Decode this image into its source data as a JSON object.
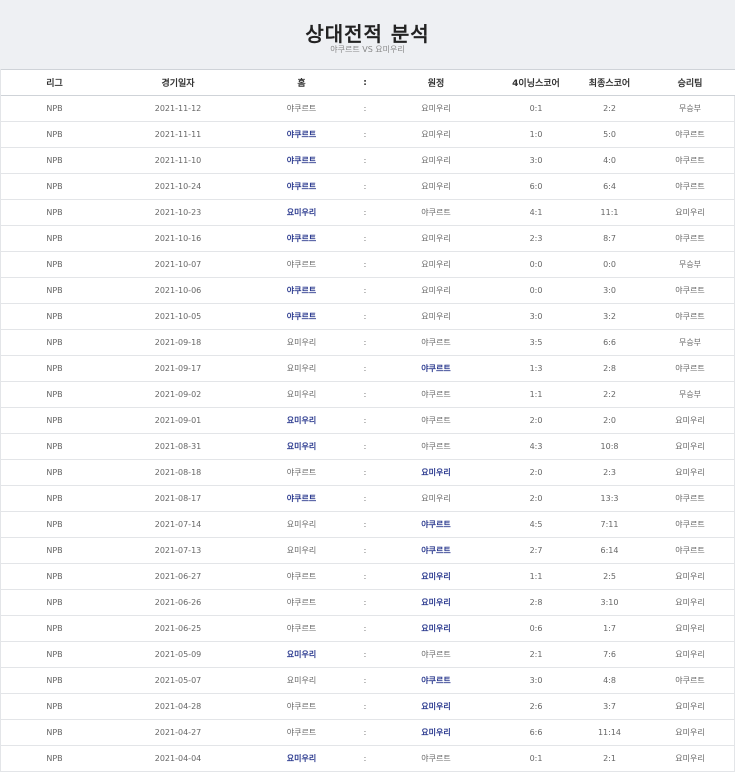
{
  "title": "상대전적 분석",
  "subtitle": "야쿠르트 VS 요미우리",
  "columns": [
    "리그",
    "경기일자",
    "홈",
    ":",
    "원정",
    "4이닝스코어",
    "최종스코어",
    "승리팀"
  ],
  "rows": [
    {
      "league": "NPB",
      "date": "2021-11-12",
      "home": "야쿠르트",
      "sep": ":",
      "away": "요미우리",
      "inning4": "0:1",
      "final": "2:2",
      "winner": "무승부",
      "win_side": "none"
    },
    {
      "league": "NPB",
      "date": "2021-11-11",
      "home": "야쿠르트",
      "sep": ":",
      "away": "요미우리",
      "inning4": "1:0",
      "final": "5:0",
      "winner": "야쿠르트",
      "win_side": "home"
    },
    {
      "league": "NPB",
      "date": "2021-11-10",
      "home": "야쿠르트",
      "sep": ":",
      "away": "요미우리",
      "inning4": "3:0",
      "final": "4:0",
      "winner": "야쿠르트",
      "win_side": "home"
    },
    {
      "league": "NPB",
      "date": "2021-10-24",
      "home": "야쿠르트",
      "sep": ":",
      "away": "요미우리",
      "inning4": "6:0",
      "final": "6:4",
      "winner": "야쿠르트",
      "win_side": "home"
    },
    {
      "league": "NPB",
      "date": "2021-10-23",
      "home": "요미우리",
      "sep": ":",
      "away": "야쿠르트",
      "inning4": "4:1",
      "final": "11:1",
      "winner": "요미우리",
      "win_side": "home"
    },
    {
      "league": "NPB",
      "date": "2021-10-16",
      "home": "야쿠르트",
      "sep": ":",
      "away": "요미우리",
      "inning4": "2:3",
      "final": "8:7",
      "winner": "야쿠르트",
      "win_side": "home"
    },
    {
      "league": "NPB",
      "date": "2021-10-07",
      "home": "야쿠르트",
      "sep": ":",
      "away": "요미우리",
      "inning4": "0:0",
      "final": "0:0",
      "winner": "무승부",
      "win_side": "none"
    },
    {
      "league": "NPB",
      "date": "2021-10-06",
      "home": "야쿠르트",
      "sep": ":",
      "away": "요미우리",
      "inning4": "0:0",
      "final": "3:0",
      "winner": "야쿠르트",
      "win_side": "home"
    },
    {
      "league": "NPB",
      "date": "2021-10-05",
      "home": "야쿠르트",
      "sep": ":",
      "away": "요미우리",
      "inning4": "3:0",
      "final": "3:2",
      "winner": "야쿠르트",
      "win_side": "home"
    },
    {
      "league": "NPB",
      "date": "2021-09-18",
      "home": "요미우리",
      "sep": ":",
      "away": "야쿠르트",
      "inning4": "3:5",
      "final": "6:6",
      "winner": "무승부",
      "win_side": "none"
    },
    {
      "league": "NPB",
      "date": "2021-09-17",
      "home": "요미우리",
      "sep": ":",
      "away": "야쿠르트",
      "inning4": "1:3",
      "final": "2:8",
      "winner": "야쿠르트",
      "win_side": "away"
    },
    {
      "league": "NPB",
      "date": "2021-09-02",
      "home": "요미우리",
      "sep": ":",
      "away": "야쿠르트",
      "inning4": "1:1",
      "final": "2:2",
      "winner": "무승부",
      "win_side": "none"
    },
    {
      "league": "NPB",
      "date": "2021-09-01",
      "home": "요미우리",
      "sep": ":",
      "away": "야쿠르트",
      "inning4": "2:0",
      "final": "2:0",
      "winner": "요미우리",
      "win_side": "home"
    },
    {
      "league": "NPB",
      "date": "2021-08-31",
      "home": "요미우리",
      "sep": ":",
      "away": "야쿠르트",
      "inning4": "4:3",
      "final": "10:8",
      "winner": "요미우리",
      "win_side": "home"
    },
    {
      "league": "NPB",
      "date": "2021-08-18",
      "home": "야쿠르트",
      "sep": ":",
      "away": "요미우리",
      "inning4": "2:0",
      "final": "2:3",
      "winner": "요미우리",
      "win_side": "away"
    },
    {
      "league": "NPB",
      "date": "2021-08-17",
      "home": "야쿠르트",
      "sep": ":",
      "away": "요미우리",
      "inning4": "2:0",
      "final": "13:3",
      "winner": "야쿠르트",
      "win_side": "home"
    },
    {
      "league": "NPB",
      "date": "2021-07-14",
      "home": "요미우리",
      "sep": ":",
      "away": "야쿠르트",
      "inning4": "4:5",
      "final": "7:11",
      "winner": "야쿠르트",
      "win_side": "away"
    },
    {
      "league": "NPB",
      "date": "2021-07-13",
      "home": "요미우리",
      "sep": ":",
      "away": "야쿠르트",
      "inning4": "2:7",
      "final": "6:14",
      "winner": "야쿠르트",
      "win_side": "away"
    },
    {
      "league": "NPB",
      "date": "2021-06-27",
      "home": "야쿠르트",
      "sep": ":",
      "away": "요미우리",
      "inning4": "1:1",
      "final": "2:5",
      "winner": "요미우리",
      "win_side": "away"
    },
    {
      "league": "NPB",
      "date": "2021-06-26",
      "home": "야쿠르트",
      "sep": ":",
      "away": "요미우리",
      "inning4": "2:8",
      "final": "3:10",
      "winner": "요미우리",
      "win_side": "away"
    },
    {
      "league": "NPB",
      "date": "2021-06-25",
      "home": "야쿠르트",
      "sep": ":",
      "away": "요미우리",
      "inning4": "0:6",
      "final": "1:7",
      "winner": "요미우리",
      "win_side": "away"
    },
    {
      "league": "NPB",
      "date": "2021-05-09",
      "home": "요미우리",
      "sep": ":",
      "away": "야쿠르트",
      "inning4": "2:1",
      "final": "7:6",
      "winner": "요미우리",
      "win_side": "home"
    },
    {
      "league": "NPB",
      "date": "2021-05-07",
      "home": "요미우리",
      "sep": ":",
      "away": "야쿠르트",
      "inning4": "3:0",
      "final": "4:8",
      "winner": "야쿠르트",
      "win_side": "away"
    },
    {
      "league": "NPB",
      "date": "2021-04-28",
      "home": "야쿠르트",
      "sep": ":",
      "away": "요미우리",
      "inning4": "2:6",
      "final": "3:7",
      "winner": "요미우리",
      "win_side": "away"
    },
    {
      "league": "NPB",
      "date": "2021-04-27",
      "home": "야쿠르트",
      "sep": ":",
      "away": "요미우리",
      "inning4": "6:6",
      "final": "11:14",
      "winner": "요미우리",
      "win_side": "away"
    },
    {
      "league": "NPB",
      "date": "2021-04-04",
      "home": "요미우리",
      "sep": ":",
      "away": "야쿠르트",
      "inning4": "0:1",
      "final": "2:1",
      "winner": "요미우리",
      "win_side": "home"
    }
  ],
  "colors": {
    "header_bg": "#eef0f3",
    "winner_text": "#2b3a8f",
    "row_border": "#e3e5e8"
  }
}
